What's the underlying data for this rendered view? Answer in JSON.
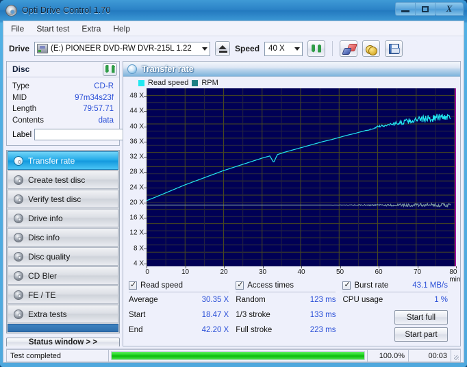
{
  "window": {
    "title": "Opti Drive Control 1.70",
    "app_icon": "disc-icon",
    "minimize": "–",
    "maximize": "□",
    "close": "X"
  },
  "menu": {
    "items": [
      "File",
      "Start test",
      "Extra",
      "Help"
    ]
  },
  "toolbar": {
    "drive_label": "Drive",
    "drive_value": "(E:)   PIONEER DVD-RW   DVR-215L 1.22",
    "eject_icon": "eject-icon",
    "speed_label": "Speed",
    "speed_value": "40 X",
    "refresh_icon": "refresh-icon",
    "eraser_icon": "eraser-icon",
    "coins_icon": "coins-icon",
    "save_icon": "save-icon"
  },
  "disc": {
    "title": "Disc",
    "refresh_icon": "refresh-icon",
    "rows": [
      {
        "key": "Type",
        "value": "CD-R"
      },
      {
        "key": "MID",
        "value": "97m34s23f"
      },
      {
        "key": "Length",
        "value": "79:57.71"
      },
      {
        "key": "Contents",
        "value": "data"
      }
    ],
    "label_key": "Label",
    "label_value": "",
    "label_icon": "cd-icon"
  },
  "sidebar": {
    "items": [
      {
        "label": "Transfer rate",
        "selected": true
      },
      {
        "label": "Create test disc",
        "selected": false
      },
      {
        "label": "Verify test disc",
        "selected": false
      },
      {
        "label": "Drive info",
        "selected": false
      },
      {
        "label": "Disc info",
        "selected": false
      },
      {
        "label": "Disc quality",
        "selected": false
      },
      {
        "label": "CD Bler",
        "selected": false
      },
      {
        "label": "FE / TE",
        "selected": false
      },
      {
        "label": "Extra tests",
        "selected": false
      }
    ],
    "status_window_button": "Status window > >"
  },
  "chart_panel": {
    "title": "Transfer rate",
    "icon": "disc-icon",
    "legend": [
      {
        "label": "Read speed",
        "color": "#22e8f0"
      },
      {
        "label": "RPM",
        "color": "#1d7f84"
      }
    ]
  },
  "chart_data": {
    "type": "line",
    "title": "Transfer rate",
    "xlabel": "min",
    "ylabel": "X",
    "xlim": [
      0,
      80
    ],
    "ylim": [
      0,
      50
    ],
    "xticks": [
      0,
      10,
      20,
      30,
      40,
      50,
      60,
      70,
      80
    ],
    "xtick_labels": [
      "0",
      "10",
      "20",
      "30",
      "40",
      "50",
      "60",
      "70",
      "80 min"
    ],
    "yticks": [
      4,
      8,
      12,
      16,
      20,
      24,
      28,
      32,
      36,
      40,
      44,
      48
    ],
    "ytick_labels": [
      "4 X",
      "8 X",
      "12 X",
      "16 X",
      "20 X",
      "24 X",
      "28 X",
      "32 X",
      "36 X",
      "40 X",
      "44 X",
      "48 X"
    ],
    "grid": true,
    "background": "#000055",
    "gridcolor": "#4a4a1e",
    "legend_position": "top-left",
    "series": [
      {
        "name": "Read speed",
        "color": "#22e8f0",
        "x": [
          0,
          2,
          4,
          6,
          8,
          10,
          12,
          14,
          16,
          18,
          20,
          22,
          24,
          26,
          28,
          30,
          32,
          33,
          34,
          36,
          38,
          40,
          42,
          44,
          46,
          48,
          50,
          52,
          54,
          56,
          58,
          60,
          62,
          64,
          66,
          68,
          70,
          72,
          74,
          76,
          78,
          79
        ],
        "y": [
          18.47,
          19.3,
          20.2,
          21.1,
          22.0,
          22.9,
          23.7,
          24.5,
          25.3,
          26.1,
          26.9,
          27.6,
          28.3,
          29.0,
          29.7,
          30.4,
          31.0,
          29.2,
          31.4,
          32.1,
          32.7,
          33.3,
          33.9,
          34.5,
          35.1,
          35.6,
          36.2,
          36.8,
          37.3,
          37.9,
          38.4,
          39.2,
          39.6,
          40.1,
          40.3,
          40.8,
          41.0,
          41.4,
          41.6,
          41.9,
          42.1,
          42.2
        ],
        "noise_start_x": 56,
        "noise_amplitude": 1.1
      },
      {
        "name": "RPM",
        "color": "#7b9aa0",
        "x": [
          0,
          10,
          20,
          30,
          40,
          50,
          55,
          60,
          65,
          70,
          75,
          79
        ],
        "y": [
          17.2,
          17.2,
          17.2,
          17.2,
          17.2,
          17.2,
          17.2,
          17.2,
          17.2,
          17.2,
          17.2,
          17.2
        ],
        "noise_start_x": 48,
        "noise_amplitude": 0.45
      }
    ]
  },
  "stats": {
    "read_speed": {
      "title": "Read speed",
      "checked": true,
      "rows": [
        {
          "key": "Average",
          "value": "30.35 X"
        },
        {
          "key": "Start",
          "value": "18.47 X"
        },
        {
          "key": "End",
          "value": "42.20 X"
        }
      ]
    },
    "access_times": {
      "title": "Access times",
      "checked": true,
      "rows": [
        {
          "key": "Random",
          "value": "123 ms"
        },
        {
          "key": "1/3 stroke",
          "value": "133 ms"
        },
        {
          "key": "Full stroke",
          "value": "223 ms"
        }
      ]
    },
    "burst": {
      "title": "Burst rate",
      "checked": true,
      "value": "43.1 MB/s",
      "cpu_key": "CPU usage",
      "cpu_value": "1 %",
      "start_full": "Start full",
      "start_part": "Start part"
    }
  },
  "statusbar": {
    "text": "Test completed",
    "progress_percent": 100.0,
    "percent_label": "100.0%",
    "elapsed": "00:03"
  }
}
